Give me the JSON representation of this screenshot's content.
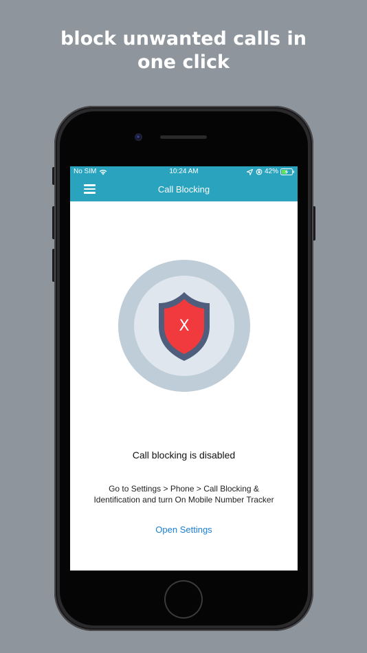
{
  "headline": {
    "line1": "block unwanted calls in",
    "line2": "one click"
  },
  "status_bar": {
    "carrier": "No SIM",
    "time": "10:24 AM",
    "battery": "42%",
    "icons": [
      "wifi-icon",
      "location-arrow-icon",
      "orientation-lock-icon",
      "battery-icon"
    ]
  },
  "navbar": {
    "title": "Call Blocking",
    "menu_icon": "hamburger-menu-icon"
  },
  "status_illustration": {
    "icon": "shield-x-icon",
    "colors": {
      "outer_ring": "#bfcdd8",
      "inner_circle": "#dfe6ed",
      "shield_border": "#4f5e7d",
      "shield_fill": "#f03a3e",
      "mark": "#ffffff"
    }
  },
  "mark_text": "X",
  "status": {
    "title": "Call blocking is disabled",
    "instructions_line1": "Go to Settings > Phone > Call Blocking &",
    "instructions_line2": "Identification and turn On Mobile Number Tracker"
  },
  "actions": {
    "open_settings": "Open Settings"
  },
  "colors": {
    "background": "#8e959c",
    "header": "#2aa3be",
    "link": "#1a7fd3"
  }
}
